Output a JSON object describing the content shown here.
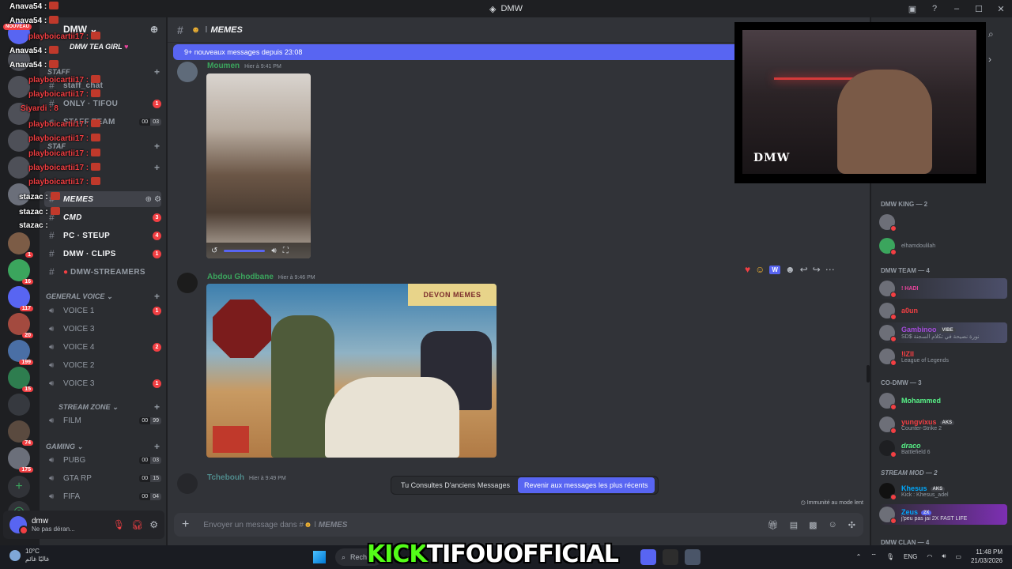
{
  "window": {
    "title": "DMW"
  },
  "overlay_chat": [
    {
      "name": "Anava54 :",
      "color": "white"
    },
    {
      "name": "Anava54 :",
      "color": "white"
    },
    {
      "name": "playboicartii17 :",
      "color": "red"
    },
    {
      "name": "Anava54 :",
      "color": "white"
    },
    {
      "name": "Anava54 :",
      "color": "white"
    },
    {
      "name": "playboicartii17 :",
      "color": "red"
    },
    {
      "name": "playboicartii17 :",
      "color": "red"
    },
    {
      "name": "Siyardi : 8",
      "color": "red"
    },
    {
      "name": "playboicartii17 :",
      "color": "red"
    },
    {
      "name": "playboicartii17 :",
      "color": "red"
    },
    {
      "name": "playboicartii17 :",
      "color": "red"
    },
    {
      "name": "playboicartii17 :",
      "color": "red"
    },
    {
      "name": "playboicartii17 :",
      "color": "red"
    },
    {
      "name": "stazac :",
      "color": "white"
    },
    {
      "name": "stazac :",
      "color": "white"
    },
    {
      "name": "stazac :",
      "color": "white"
    }
  ],
  "overlay_badge": "NOUVEAU",
  "server": {
    "name": "DMW",
    "tagline": "DMW TEA GIRL"
  },
  "sidebar": {
    "cat_staff": "STAFF",
    "staff_chat": "staff_chat",
    "only_tifou": "ONLY · TIFOU",
    "staff_team": "STAFF TEAM",
    "cat_staf": "STAF",
    "memes": "MEMES",
    "cmd": "CMD",
    "pc_steup": "PC · STEUP",
    "dmw_clips": "DMW · CLIPS",
    "dmw_streamers": "DMW-STREAMERS",
    "cat_general_voice": "GENERAL VOICE",
    "voice_1": "VOICE 1",
    "voice_3a": "VOICE 3",
    "voice_4": "VOICE 4",
    "voice_2": "VOICE 2",
    "voice_3b": "VOICE 3",
    "cat_stream_zone": "STREAM ZONE",
    "film": "FILM",
    "cat_gaming": "GAMING",
    "pubg": "PUBG",
    "gta_rp": "GTA RP",
    "fifa": "FIFA",
    "badges": {
      "only_tifou": "1",
      "cmd": "3",
      "pc_steup": "4",
      "dmw_clips": "1",
      "voice_1": "1",
      "voice_4": "2",
      "voice_3b": "1"
    },
    "counts": {
      "staff_team": [
        "00",
        "03"
      ],
      "film": [
        "00",
        "99"
      ],
      "pubg": [
        "00",
        "03"
      ],
      "gta_rp": [
        "00",
        "15"
      ],
      "fifa": [
        "00",
        "04"
      ]
    }
  },
  "user": {
    "name": "dmw",
    "status": "Ne pas déran..."
  },
  "channel": {
    "name": "MEMES",
    "new_messages": "9+ nouveaux messages depuis 23:08"
  },
  "messages": [
    {
      "author": "Moumen",
      "time": "Hier à 9:41 PM",
      "color": "#3ba55d"
    },
    {
      "author": "Abdou Ghodbane",
      "time": "Hier à 9:46 PM",
      "color": "#3ba55d"
    },
    {
      "author": "Tchebouh",
      "time": "Hier à 9:49 PM",
      "color": "#4f8a8b"
    }
  ],
  "meme_logo": "DEVON MEMES",
  "old_messages": {
    "label": "Tu Consultes D'anciens Messages",
    "jump": "Revenir aux messages les plus récents"
  },
  "slow_mode": "Immunité au mode lent",
  "composer": {
    "placeholder": "Envoyer un message dans #",
    "channel": "MEMES"
  },
  "webcam": {
    "tag": "DMW"
  },
  "members": {
    "cat_king": "DMW KING — 2",
    "king_2": "elhamdoulilah",
    "cat_team": "DMW TEAM — 4",
    "team_1": "! HADI",
    "team_2": "a0un",
    "team_3": "Gambinoo",
    "team_3_tag": "VIBE",
    "team_3_status": "SD$ نورة نصيحة في تكلام السجنة",
    "team_4": "!IZII",
    "team_4_status": "League of Legends",
    "cat_co": "CO-DMW — 3",
    "co_1": "Mohammed",
    "co_2": "yungvixus",
    "co_2_tag": "AKS",
    "co_2_status": "Counter-Strike 2",
    "co_3": "draco",
    "co_3_status": "Battlefield 6",
    "cat_mod": "STREAM MOD — 2",
    "mod_1": "Khesus",
    "mod_1_tag": "AKS",
    "mod_1_status": "Kick : Khesus_adel",
    "mod_2": "Zeus",
    "mod_2_tag": "2X",
    "mod_2_status": "j'peu pas jai 2X FAST LIFE",
    "cat_clan": "DMW CLAN — 4"
  },
  "taskbar": {
    "temp": "10°C",
    "weather_text": "غالبًا غائم",
    "search": "Rech",
    "kick_prefix": "KICK",
    "kick_name": "TIFOUOFFICIAL",
    "lang": "ENG",
    "time": "11:48 PM",
    "date": "21/03/2026"
  }
}
